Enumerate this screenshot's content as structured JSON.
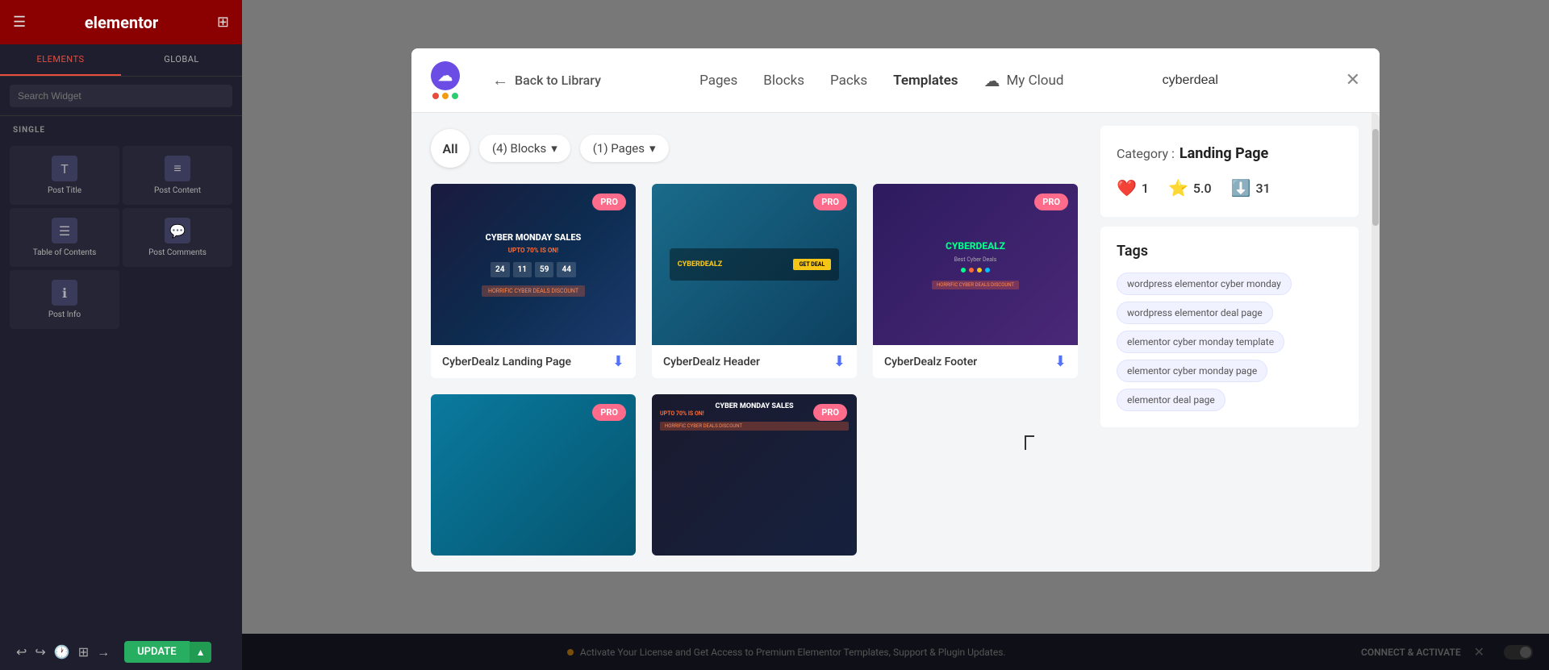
{
  "editor": {
    "title": "elementor",
    "tabs": [
      {
        "label": "ELEMENTS",
        "active": true
      },
      {
        "label": "GLOBAL",
        "active": false
      }
    ],
    "search_placeholder": "Search Widget",
    "section_single": "SINGLE",
    "widgets": [
      {
        "icon": "T",
        "label": "Post Title"
      },
      {
        "icon": "≡",
        "label": "Post Content"
      },
      {
        "icon": "☰",
        "label": "Table of Contents"
      },
      {
        "icon": "💬",
        "label": "Post Comments"
      },
      {
        "icon": "ℹ",
        "label": "Post Info"
      }
    ]
  },
  "modal": {
    "back_label": "Back to Library",
    "nav_items": [
      {
        "label": "Pages",
        "active": false
      },
      {
        "label": "Blocks",
        "active": false
      },
      {
        "label": "Packs",
        "active": false
      },
      {
        "label": "Templates",
        "active": true
      },
      {
        "label": "My Cloud",
        "active": false
      }
    ],
    "search_value": "cyberdeal",
    "close_icon": "✕",
    "filters": {
      "all_label": "All",
      "blocks_label": "(4)  Blocks",
      "pages_label": "(1)  Pages"
    },
    "templates": [
      {
        "id": 1,
        "name": "CyberDealz Landing Page",
        "badge": "PRO",
        "type": "landing",
        "cyber_headline": "CYBER MONDAY SALES",
        "cyber_sub": "UPTO 70% IS ON!",
        "countdown": [
          "24",
          "11",
          "59",
          "44"
        ]
      },
      {
        "id": 2,
        "name": "CyberDealz Header",
        "badge": "PRO",
        "type": "header"
      },
      {
        "id": 3,
        "name": "CyberDealz Footer",
        "badge": "PRO",
        "type": "footer",
        "footer_logo": "CYBERDEALZ",
        "footer_dots": [
          "#00ff88",
          "#ff6b35",
          "#f5c518",
          "#00bfff"
        ]
      },
      {
        "id": 4,
        "name": "",
        "badge": "PRO",
        "type": "blue"
      },
      {
        "id": 5,
        "name": "",
        "badge": "PRO",
        "type": "dark_cyber",
        "cyber_headline": "CYBER MONDAY SALES",
        "cyber_sub": "UPTO 70% IS ON!"
      }
    ],
    "sidebar": {
      "category_label": "Category :",
      "category_value": "Landing Page",
      "stats": {
        "likes": "1",
        "rating": "5.0",
        "downloads": "31"
      },
      "tags_title": "Tags",
      "tags": [
        "wordpress elementor cyber monday",
        "wordpress elementor deal page",
        "elementor cyber monday template",
        "elementor cyber monday page",
        "elementor deal page"
      ]
    }
  },
  "bottom_bar": {
    "activate_text": "Activate Your License and Get Access to Premium Elementor Templates, Support & Plugin Updates.",
    "connect_label": "CONNECT & ACTIVATE",
    "update_label": "UPDATE"
  },
  "logo": {
    "dots": [
      "#e74c3c",
      "#f39c12",
      "#2ecc71"
    ]
  }
}
